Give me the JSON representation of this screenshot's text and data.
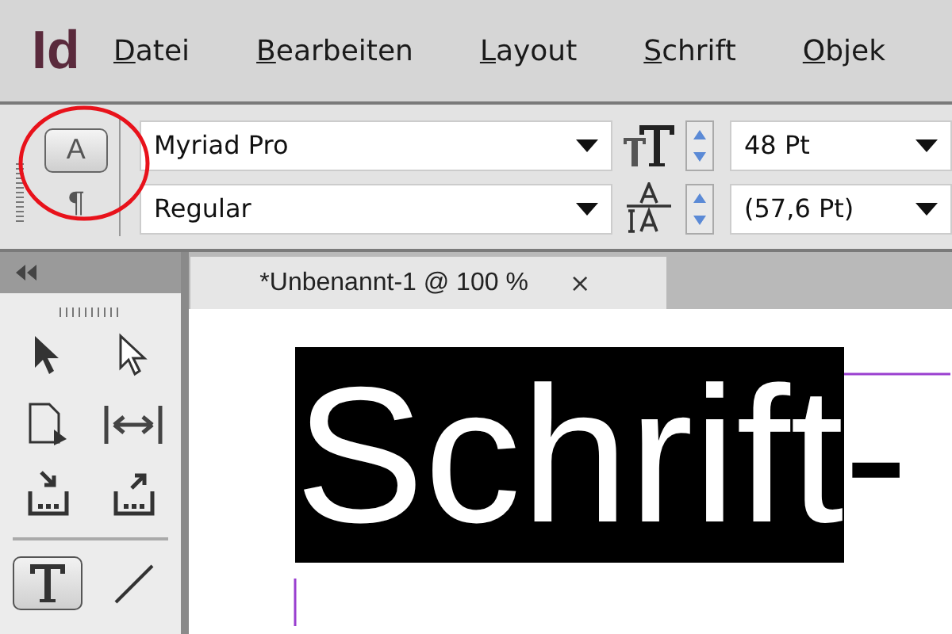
{
  "app": {
    "logo": "Id"
  },
  "menu": [
    "Datei",
    "Bearbeiten",
    "Layout",
    "Schrift",
    "Objek"
  ],
  "control_panel": {
    "modes": [
      {
        "kind": "character",
        "label": "A",
        "selected": true
      },
      {
        "kind": "paragraph",
        "label": "¶",
        "selected": false
      }
    ],
    "font_family": "Myriad Pro",
    "font_style": "Regular",
    "font_size": "48 Pt",
    "leading": "(57,6 Pt)",
    "annotation": {
      "kind": "circle",
      "color": "#e8121b"
    }
  },
  "tools_panel": {
    "tools": [
      {
        "kind": "selection",
        "selected": false
      },
      {
        "kind": "direct-selection",
        "selected": false
      },
      {
        "kind": "page",
        "selected": false
      },
      {
        "kind": "gap",
        "selected": false
      },
      {
        "kind": "collector",
        "selected": false
      },
      {
        "kind": "placer",
        "selected": false
      },
      {
        "kind": "type",
        "selected": true
      },
      {
        "kind": "line",
        "selected": false
      }
    ]
  },
  "document_tab": {
    "title": "*Unbenannt-1 @ 100 %",
    "close": "×"
  },
  "canvas": {
    "selected_text": "Schrift",
    "rest_text": "-"
  }
}
